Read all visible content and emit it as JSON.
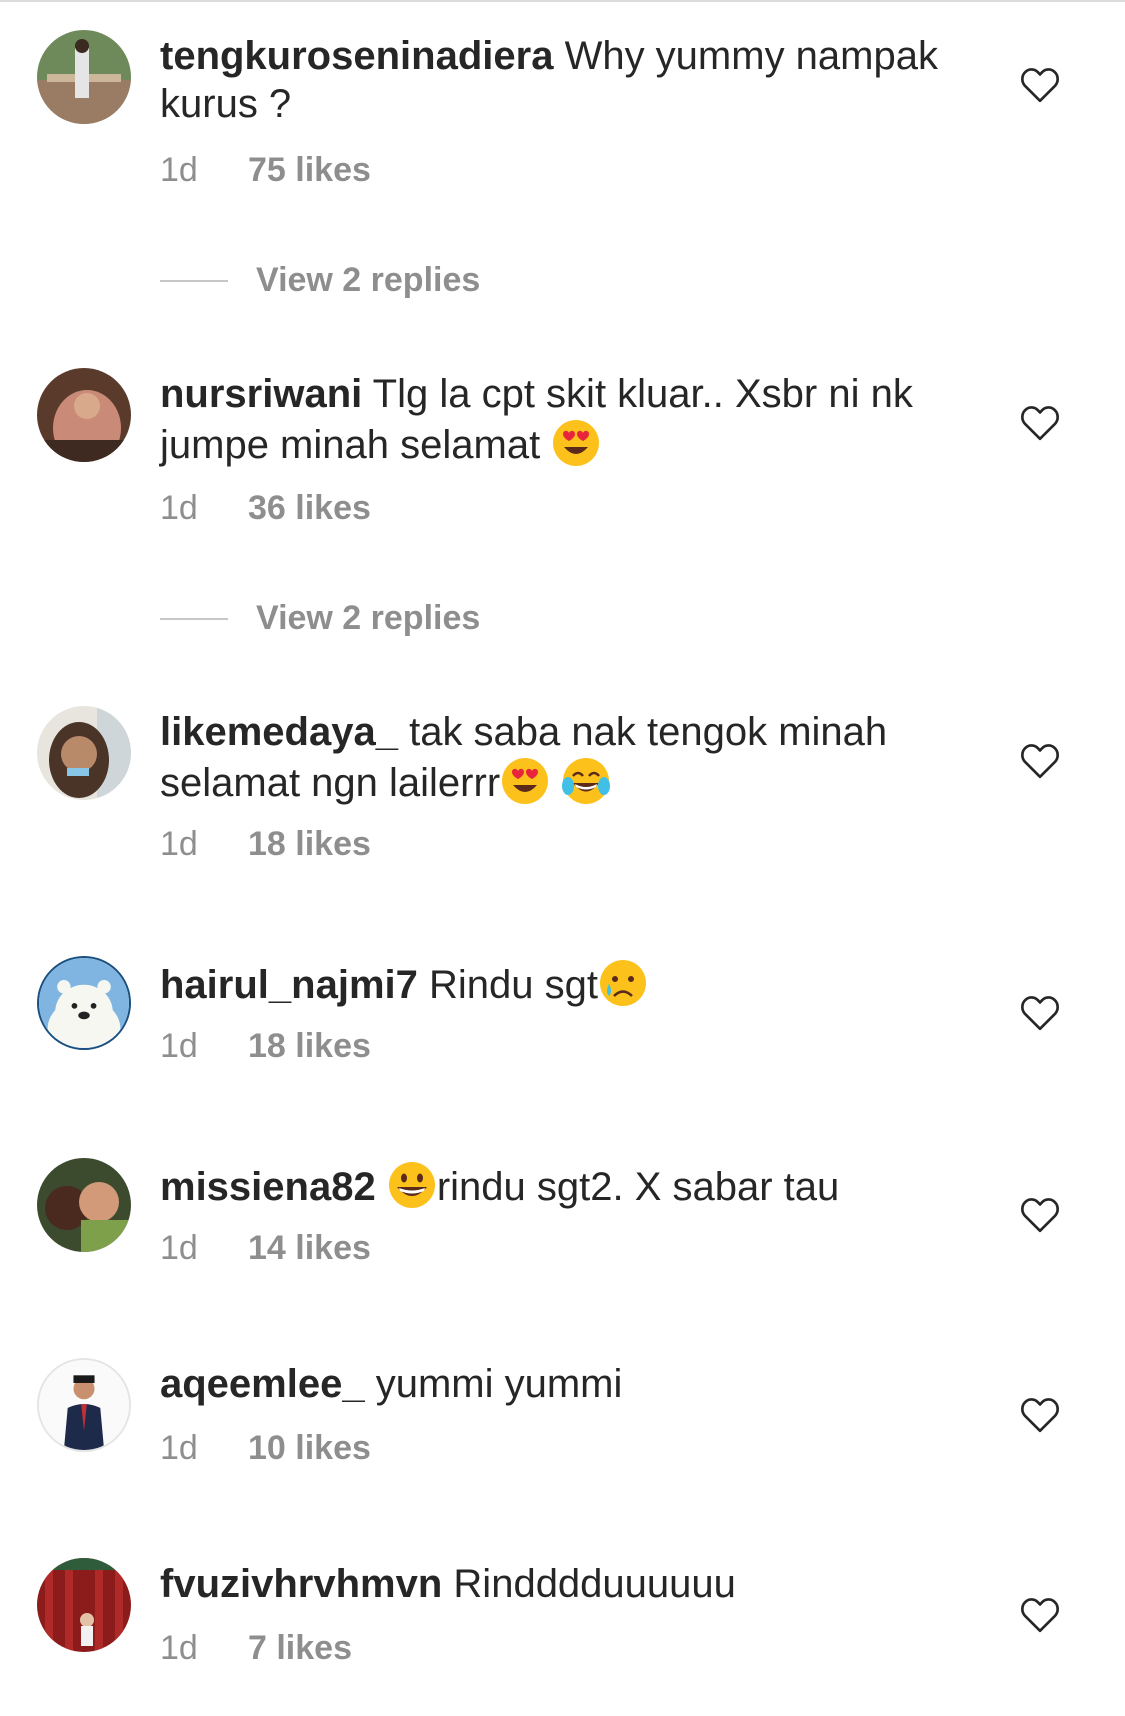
{
  "comments": [
    {
      "username": "tengkuroseninadiera",
      "text": "Why yummy nampak kurus ?",
      "time": "1d",
      "likes": "75 likes",
      "replies": "View 2 replies"
    },
    {
      "username": "nursriwani",
      "text": "Tlg la cpt skit kluar.. Xsbr ni nk jumpe minah selamat ",
      "emojis": [
        "heart-eyes"
      ],
      "time": "1d",
      "likes": "36 likes",
      "replies": "View 2 replies"
    },
    {
      "username": "likemedaya_",
      "text": "tak saba nak tengok minah selamat ngn lailerrr",
      "emojis": [
        "heart-eyes",
        "tears-of-joy"
      ],
      "time": "1d",
      "likes": "18 likes"
    },
    {
      "username": "hairul_najmi7",
      "text": "Rindu sgt",
      "emojis": [
        "crying-face"
      ],
      "time": "1d",
      "likes": "18 likes"
    },
    {
      "username": "missiena82",
      "text": "rindu sgt2. X sabar tau",
      "emojis": [
        "grinning-face"
      ],
      "time": "1d",
      "likes": "14 likes"
    },
    {
      "username": "aqeemlee_",
      "text": "yummi yummi",
      "time": "1d",
      "likes": "10 likes"
    },
    {
      "username": "fvuzivhrvhmvn",
      "text": "Rindddduuuuuu",
      "time": "1d",
      "likes": "7 likes"
    }
  ],
  "icons": {
    "like": "heart-outline-icon"
  },
  "colors": {
    "text": "#262626",
    "secondary": "#8e8e8e",
    "divider": "#c7c7c7"
  }
}
